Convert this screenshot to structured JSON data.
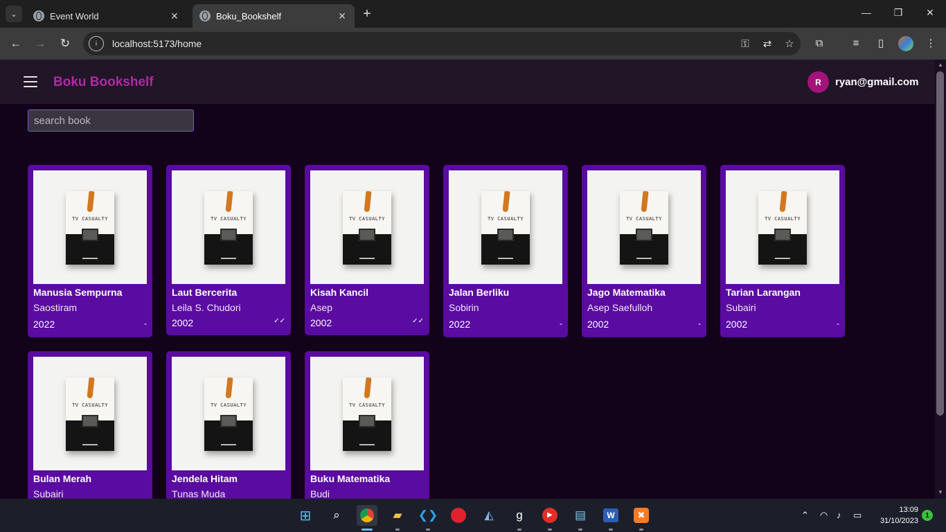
{
  "browser": {
    "tabs": [
      {
        "title": "Event World",
        "close": "✕"
      },
      {
        "title": "Boku_Bookshelf",
        "close": "✕"
      }
    ],
    "new_tab": "+",
    "url": "localhost:5173/home",
    "window_controls": {
      "minimize": "—",
      "maximize": "❐",
      "close": "✕"
    }
  },
  "app": {
    "brand": "Boku Bookshelf",
    "user": {
      "initial": "R",
      "email": "ryan@gmail.com"
    },
    "search": {
      "placeholder": "search book",
      "value": ""
    }
  },
  "books": [
    {
      "title": "Manusia Sempurna",
      "author": "Saostiram",
      "year": "2022",
      "status": "-",
      "cover_title": "TV CASUALTY"
    },
    {
      "title": "Laut Bercerita",
      "author": "Leila S. Chudori",
      "year": "2002",
      "status": "✓✓",
      "cover_title": "TV CASUALTY"
    },
    {
      "title": "Kisah Kancil",
      "author": "Asep",
      "year": "2002",
      "status": "✓✓",
      "cover_title": "TV CASUALTY"
    },
    {
      "title": "Jalan Berliku",
      "author": "Sobirin",
      "year": "2022",
      "status": "-",
      "cover_title": "TV CASUALTY"
    },
    {
      "title": "Jago Matematika",
      "author": "Asep Saefulloh",
      "year": "2002",
      "status": "-",
      "cover_title": "TV CASUALTY"
    },
    {
      "title": "Tarian Larangan",
      "author": "Subairi",
      "year": "2002",
      "status": "-",
      "cover_title": "TV CASUALTY"
    },
    {
      "title": "Bulan Merah",
      "author": "Subairi",
      "year": "",
      "status": "",
      "cover_title": "TV CASUALTY"
    },
    {
      "title": "Jendela Hitam",
      "author": "Tunas Muda",
      "year": "",
      "status": "",
      "cover_title": "TV CASUALTY"
    },
    {
      "title": "Buku Matematika",
      "author": "Budi",
      "year": "",
      "status": "",
      "cover_title": "TV CASUALTY"
    }
  ],
  "taskbar": {
    "time": "13:09",
    "date": "31/10/2023",
    "notifications": "1",
    "apps": [
      "windows-start",
      "search",
      "chrome",
      "file-explorer",
      "vscode",
      "app-red",
      "resource-monitor",
      "app-g",
      "youtube-music",
      "notepad",
      "word",
      "xampp"
    ]
  },
  "colors": {
    "page_bg": "#12021a",
    "header_bg": "#211528",
    "brand": "#b02aa3",
    "card_bg": "#5a0ba1",
    "avatar_bg": "#a3137a",
    "search_border": "#6e5fd8"
  }
}
